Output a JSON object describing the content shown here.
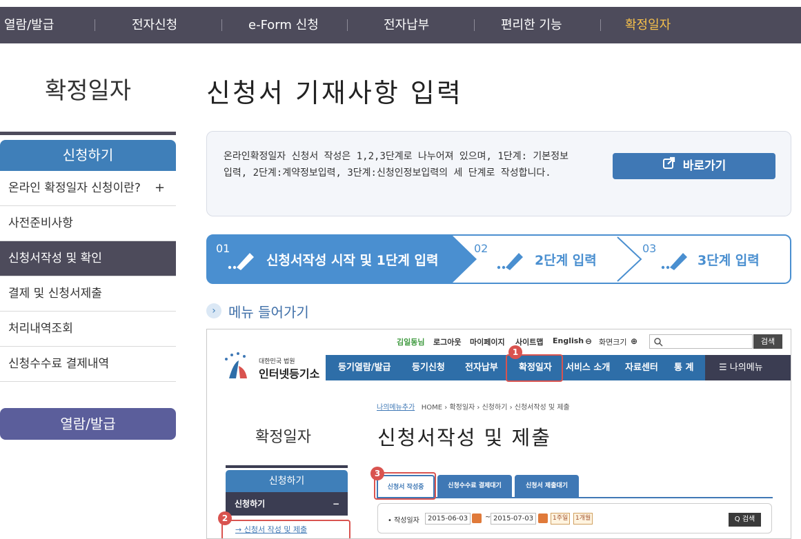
{
  "topnav": {
    "items": [
      "열람/발급",
      "전자신청",
      "e-Form 신청",
      "전자납부",
      "편리한 기능",
      "확정일자"
    ],
    "active_index": 5
  },
  "sidebar": {
    "title": "확정일자",
    "section_head": "신청하기",
    "items": [
      "온라인 확정일자 신청이란?",
      "사전준비사항",
      "신청서작성 및 확인",
      "결제 및 신청서제출",
      "처리내역조회",
      "신청수수료 결제내역"
    ],
    "plus_symbol": "+",
    "active_index": 2,
    "bottom_button": "열람/발급"
  },
  "main": {
    "title": "신청서 기재사항 입력",
    "info_text": "온라인확정일자 신청서 작성은 1,2,3단계로 나누어져 있으며, 1단계: 기본정보입력, 2단계:계약정보입력, 3단계:신청인정보입력의 세 단계로 작성합니다.",
    "goto_button": "바로가기",
    "steps": [
      {
        "num": "01",
        "label": "신청서작성 시작 및 1단계 입력"
      },
      {
        "num": "02",
        "label": "2단계 입력"
      },
      {
        "num": "03",
        "label": "3단계 입력"
      }
    ],
    "menu_heading": "메뉴 들어가기",
    "menu_arrow": "›"
  },
  "screenshot": {
    "util": {
      "user": "김일동님",
      "logout": "로그아웃",
      "mypage": "마이페이지",
      "sitemap": "사이트맵",
      "english": "English",
      "zoom_label": "화면크기",
      "search_button": "검색"
    },
    "logo_small": "대한민국 법원",
    "logo_big": "인터넷등기소",
    "nav": [
      "등기열람/발급",
      "등기신청",
      "전자납부",
      "확정일자",
      "서비스 소개",
      "자료센터",
      "통 계"
    ],
    "my_menu": "☰  나의메뉴",
    "breadcrumb_my": "나의메뉴추가",
    "breadcrumb": "HOME › 확정일자 › 신청하기 › 신청서작성 및 제출",
    "side_title": "확정일자",
    "page_title": "신청서작성 및 제출",
    "side_head": "신청하기",
    "side_active": "신청하기",
    "side_minus": "−",
    "side_sub": "→ 신청서 작성 및 제출",
    "tabs": [
      "신청서 작성중",
      "신청수수료 결제대기",
      "신청서 제출대기"
    ],
    "date_label": "• 작성일자",
    "date_from": "2015-06-03",
    "date_to": "2015-07-03",
    "date_tilde": "~",
    "period_1": "1주일",
    "period_2": "1개월",
    "search_button": "Q 검색",
    "badges": [
      "1",
      "2",
      "3"
    ]
  },
  "colors": {
    "topnav_bg": "#4d4b5b",
    "active_nav": "#f7c14b",
    "accent_blue": "#3f7fb9",
    "step_active": "#4a8fd0",
    "highlight_red": "#d9534f"
  }
}
